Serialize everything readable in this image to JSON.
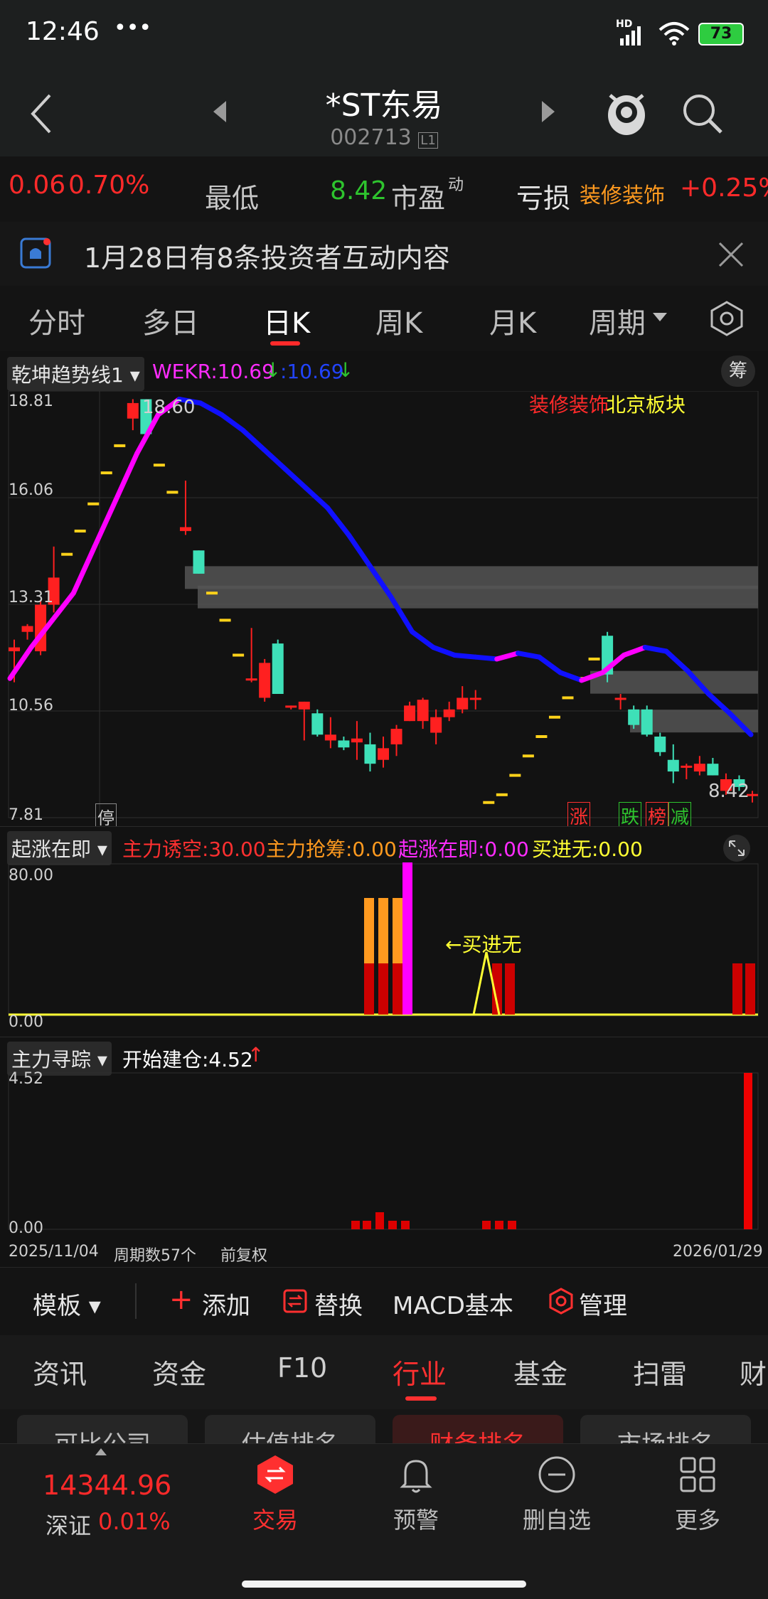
{
  "status_bar": {
    "time": "12:46",
    "dots": "•••",
    "network": "HD",
    "battery": "73"
  },
  "header": {
    "title": "*ST东易",
    "code": "002713",
    "market_badge": "L1"
  },
  "quote_row": {
    "change": "0.06",
    "change_pct": "0.70%",
    "low_label": "最低",
    "price": "8.42",
    "pe_label": "市盈",
    "pe_superscript": "动",
    "pe_value": "亏损",
    "sector_name": "装修装饰",
    "sector_change": "+0.25%"
  },
  "notice": {
    "text": "1月28日有8条投资者互动内容"
  },
  "period_tabs": [
    "分时",
    "多日",
    "日K",
    "周K",
    "月K",
    "周期"
  ],
  "period_active": "日K",
  "main_chart": {
    "indicator_name": "乾坤趋势线1",
    "wekr_label": "WEKR:10.69",
    "wekr_value2": ":10.69",
    "chip_button": "筹",
    "y_ticks": [
      "18.81",
      "16.06",
      "13.31",
      "10.56",
      "7.81"
    ],
    "high_label": "18.60",
    "last_label": "8.42",
    "sector_tag_red": "装修装饰",
    "sector_tag_yellow": "北京板块",
    "stop_badge": "停",
    "badges": [
      "涨",
      "跌",
      "榜",
      "减"
    ],
    "colors": {
      "up": "#ff2020",
      "down": "#3ee0b8",
      "trend_up": "#ff00ff",
      "trend_down": "#1010ff"
    }
  },
  "chart_data": [
    {
      "type": "candlestick",
      "title": "",
      "ylim": [
        7.81,
        18.81
      ],
      "candles": [
        {
          "o": 12.1,
          "h": 12.4,
          "l": 11.3,
          "c": 12.2
        },
        {
          "o": 12.6,
          "h": 12.8,
          "l": 12.4,
          "c": 12.75
        },
        {
          "o": 12.1,
          "h": 13.4,
          "l": 12.0,
          "c": 13.3
        },
        {
          "o": 13.3,
          "h": 14.8,
          "l": 13.1,
          "c": 14.0
        },
        {
          "o": 14.6,
          "h": 14.6,
          "l": 14.6,
          "c": 14.6
        },
        {
          "o": 15.2,
          "h": 15.2,
          "l": 15.2,
          "c": 15.2
        },
        {
          "o": 15.9,
          "h": 15.9,
          "l": 15.9,
          "c": 15.9
        },
        {
          "o": 16.7,
          "h": 16.7,
          "l": 16.7,
          "c": 16.7
        },
        {
          "o": 17.4,
          "h": 17.4,
          "l": 17.4,
          "c": 17.4
        },
        {
          "o": 18.1,
          "h": 18.6,
          "l": 17.8,
          "c": 18.5
        },
        {
          "o": 18.6,
          "h": 18.6,
          "l": 17.7,
          "c": 17.7
        },
        {
          "o": 16.9,
          "h": 16.9,
          "l": 16.9,
          "c": 16.9
        },
        {
          "o": 16.2,
          "h": 16.2,
          "l": 16.2,
          "c": 16.2
        },
        {
          "o": 15.2,
          "h": 16.5,
          "l": 15.1,
          "c": 15.3
        },
        {
          "o": 14.7,
          "h": 14.7,
          "l": 14.1,
          "c": 14.1
        },
        {
          "o": 13.6,
          "h": 13.6,
          "l": 13.6,
          "c": 13.6
        },
        {
          "o": 12.9,
          "h": 12.9,
          "l": 12.9,
          "c": 12.9
        },
        {
          "o": 12.0,
          "h": 12.0,
          "l": 12.0,
          "c": 12.0
        },
        {
          "o": 11.4,
          "h": 12.7,
          "l": 11.3,
          "c": 11.4
        },
        {
          "o": 10.9,
          "h": 11.9,
          "l": 10.8,
          "c": 11.8
        },
        {
          "o": 12.3,
          "h": 12.4,
          "l": 11.0,
          "c": 11.0
        },
        {
          "o": 10.7,
          "h": 10.7,
          "l": 10.6,
          "c": 10.7
        },
        {
          "o": 10.6,
          "h": 10.8,
          "l": 9.8,
          "c": 10.8
        },
        {
          "o": 10.5,
          "h": 10.6,
          "l": 9.9,
          "c": 9.95
        },
        {
          "o": 9.8,
          "h": 10.4,
          "l": 9.6,
          "c": 9.95
        },
        {
          "o": 9.8,
          "h": 9.9,
          "l": 9.55,
          "c": 9.62
        },
        {
          "o": 9.75,
          "h": 10.3,
          "l": 9.3,
          "c": 9.85
        },
        {
          "o": 9.7,
          "h": 10.0,
          "l": 9.0,
          "c": 9.2
        },
        {
          "o": 9.3,
          "h": 9.9,
          "l": 9.1,
          "c": 9.6
        },
        {
          "o": 9.7,
          "h": 10.2,
          "l": 9.4,
          "c": 10.1
        },
        {
          "o": 10.3,
          "h": 10.8,
          "l": 10.3,
          "c": 10.7
        },
        {
          "o": 10.3,
          "h": 10.9,
          "l": 10.1,
          "c": 10.85
        },
        {
          "o": 10.0,
          "h": 10.6,
          "l": 9.7,
          "c": 10.4
        },
        {
          "o": 10.4,
          "h": 10.8,
          "l": 10.3,
          "c": 10.6
        },
        {
          "o": 10.6,
          "h": 11.2,
          "l": 10.5,
          "c": 10.9
        },
        {
          "o": 10.9,
          "h": 11.1,
          "l": 10.6,
          "c": 10.9
        },
        {
          "o": 8.2,
          "h": 8.2,
          "l": 8.2,
          "c": 8.2
        },
        {
          "o": 8.4,
          "h": 8.4,
          "l": 8.4,
          "c": 8.4
        },
        {
          "o": 8.9,
          "h": 8.9,
          "l": 8.9,
          "c": 8.9
        },
        {
          "o": 9.4,
          "h": 9.4,
          "l": 9.4,
          "c": 9.4
        },
        {
          "o": 9.9,
          "h": 9.9,
          "l": 9.9,
          "c": 9.9
        },
        {
          "o": 10.4,
          "h": 10.4,
          "l": 10.4,
          "c": 10.4
        },
        {
          "o": 10.9,
          "h": 10.9,
          "l": 10.9,
          "c": 10.9
        },
        {
          "o": 11.4,
          "h": 11.4,
          "l": 11.4,
          "c": 11.4
        },
        {
          "o": 11.9,
          "h": 11.9,
          "l": 11.9,
          "c": 11.9
        },
        {
          "o": 12.5,
          "h": 12.6,
          "l": 11.3,
          "c": 11.5
        },
        {
          "o": 10.9,
          "h": 11.0,
          "l": 10.6,
          "c": 10.9
        },
        {
          "o": 10.6,
          "h": 10.7,
          "l": 10.1,
          "c": 10.2
        },
        {
          "o": 10.6,
          "h": 10.7,
          "l": 9.9,
          "c": 9.95
        },
        {
          "o": 9.9,
          "h": 10.0,
          "l": 9.4,
          "c": 9.5
        },
        {
          "o": 9.3,
          "h": 9.7,
          "l": 8.7,
          "c": 9.0
        },
        {
          "o": 9.15,
          "h": 9.2,
          "l": 8.8,
          "c": 9.15
        },
        {
          "o": 9.0,
          "h": 9.4,
          "l": 8.9,
          "c": 9.2
        },
        {
          "o": 9.2,
          "h": 9.35,
          "l": 8.9,
          "c": 8.9
        },
        {
          "o": 8.5,
          "h": 8.95,
          "l": 8.4,
          "c": 8.8
        },
        {
          "o": 8.8,
          "h": 8.9,
          "l": 8.5,
          "c": 8.6
        },
        {
          "o": 8.42,
          "h": 8.5,
          "l": 8.2,
          "c": 8.42
        }
      ],
      "trend_line": [
        11.4,
        12.2,
        12.9,
        13.6,
        14.8,
        16.0,
        17.2,
        18.2,
        18.6,
        18.5,
        18.2,
        17.8,
        17.3,
        16.8,
        16.3,
        15.8,
        15.1,
        14.3,
        13.5,
        12.6,
        12.2,
        12.0,
        11.95,
        11.9,
        12.05,
        11.95,
        11.55,
        11.35,
        11.55,
        12.0,
        12.2,
        12.1,
        11.6,
        11.0,
        10.5,
        9.95
      ],
      "resistance_bands": [
        "14.0",
        "13.5",
        "11.3",
        "10.3"
      ]
    },
    {
      "type": "bar",
      "title": "",
      "ylim": [
        0,
        80
      ],
      "y_ticks": [
        "80.00",
        "0.00"
      ]
    },
    {
      "type": "bar",
      "title": "",
      "ylim": [
        0,
        4.52
      ],
      "y_ticks": [
        "4.52",
        "0.00"
      ]
    }
  ],
  "indicator1": {
    "name": "起涨在即",
    "labels": [
      {
        "text": "主力诱空:30.00",
        "color": "#ff3030"
      },
      {
        "text": "主力抢筹:0.00",
        "color": "#ff9a1f"
      },
      {
        "text": "起涨在即:0.00",
        "color": "#ff2cff"
      },
      {
        "text": "买进无:0.00",
        "color": "#ffff33"
      }
    ],
    "annotation": "←买进无"
  },
  "indicator2": {
    "name": "主力寻踪",
    "label": "开始建仓:4.52",
    "arrow": "↑"
  },
  "axis_footer": {
    "start_date": "2025/11/04",
    "count_text": "周期数57个",
    "adjust": "前复权",
    "end_date": "2026/01/29"
  },
  "toolbar": {
    "template": "模板",
    "add": "添加",
    "replace": "替换",
    "macd": "MACD基本",
    "manage": "管理"
  },
  "info_tabs": [
    "资讯",
    "资金",
    "F10",
    "行业",
    "基金",
    "扫雷",
    "财"
  ],
  "info_tab_active": "行业",
  "sub_tabs": [
    "可比公司",
    "估值排名",
    "财务排名",
    "市场排名"
  ],
  "bottom_nav": {
    "index_value": "14344.96",
    "index_name": "深证",
    "index_change": "0.01%",
    "items": [
      "交易",
      "预警",
      "删自选",
      "更多"
    ]
  }
}
